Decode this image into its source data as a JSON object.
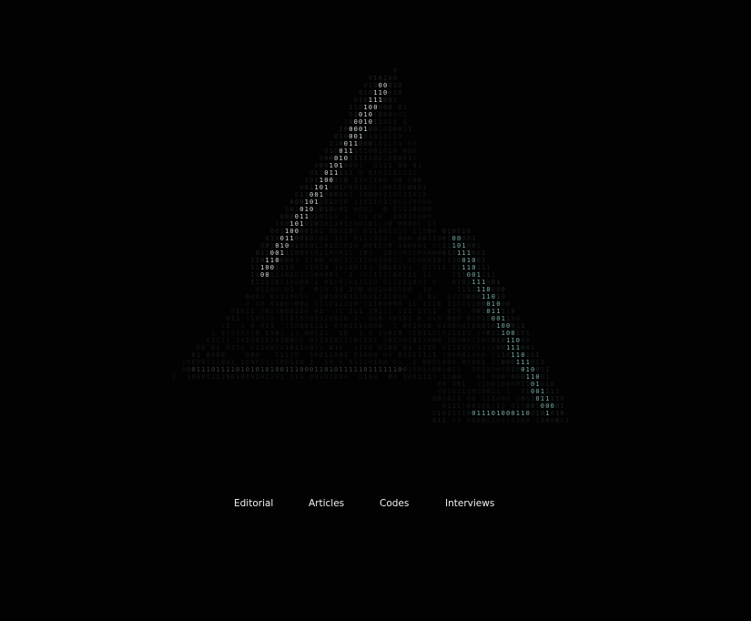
{
  "logo": {
    "icon": "binary-triangle-logo",
    "glyphs": "01",
    "colors": {
      "background": "#020202",
      "faint": "#1a1d1d",
      "dim": "#3a4242",
      "bright": "#dde6e4",
      "accent": "#7fb8b4"
    }
  },
  "nav": {
    "items": [
      {
        "label": "Editorial"
      },
      {
        "label": "Articles"
      },
      {
        "label": "Codes"
      },
      {
        "label": "Interviews"
      }
    ]
  }
}
